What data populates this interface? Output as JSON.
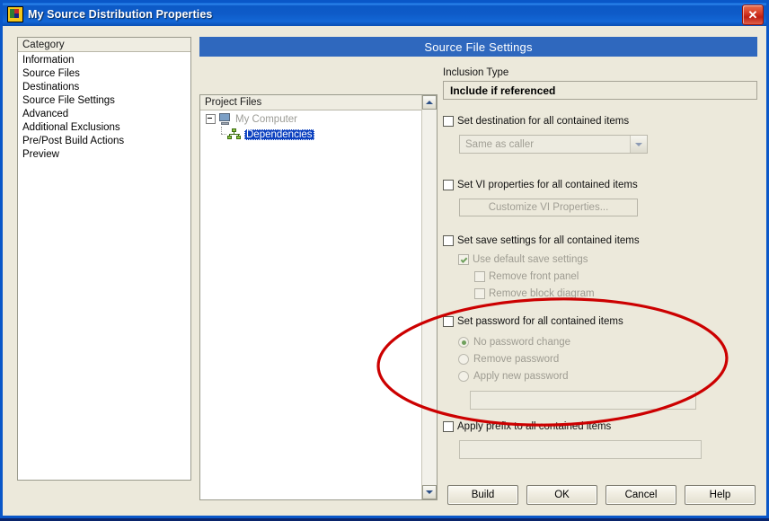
{
  "window": {
    "title": "My Source Distribution Properties",
    "app_icon": "labview-icon",
    "close_label": "✕",
    "titlebar_color": "#0C59C6",
    "background_color": "#ECE9DB"
  },
  "category": {
    "header": "Category",
    "items": [
      {
        "label": "Information",
        "selected": false
      },
      {
        "label": "Source Files",
        "selected": false
      },
      {
        "label": "Destinations",
        "selected": false
      },
      {
        "label": "Source File Settings",
        "selected": true
      },
      {
        "label": "Advanced",
        "selected": false
      },
      {
        "label": "Additional Exclusions",
        "selected": false
      },
      {
        "label": "Pre/Post Build Actions",
        "selected": false
      },
      {
        "label": "Preview",
        "selected": false
      }
    ],
    "selection_color": "#0A3FBF"
  },
  "tree": {
    "header": "Project Files",
    "nodes": [
      {
        "label": "My Computer",
        "icon": "computer-icon",
        "state": "dimmed",
        "expander": "minus"
      },
      {
        "label": "Dependencies",
        "icon": "dependencies-icon",
        "state": "selected"
      }
    ],
    "scrollbar": {
      "up": "▲",
      "down": "▼"
    }
  },
  "panel": {
    "header": "Source File Settings",
    "header_color": "#2F68BE",
    "inclusion": {
      "label": "Inclusion Type",
      "value": "Include if referenced"
    },
    "destination": {
      "checkbox_label": "Set destination for all contained items",
      "checked": false,
      "combo_value": "Same as caller",
      "combo_disabled": true
    },
    "vi_properties": {
      "checkbox_label": "Set VI properties for all contained items",
      "checked": false,
      "button_label": "Customize VI Properties...",
      "button_disabled": true
    },
    "save_settings": {
      "checkbox_label": "Set save settings for all contained items",
      "checked": false,
      "use_default": {
        "label": "Use default save settings",
        "checked": true,
        "disabled": true
      },
      "remove_front_panel": {
        "label": "Remove front panel",
        "checked": false,
        "disabled": true
      },
      "remove_block_diagram": {
        "label": "Remove block diagram",
        "checked": false,
        "disabled": true
      }
    },
    "password": {
      "checkbox_label": "Set password for all contained items",
      "checked": false,
      "options": [
        {
          "label": "No password change",
          "selected": true
        },
        {
          "label": "Remove password",
          "selected": false
        },
        {
          "label": "Apply new password",
          "selected": false
        }
      ],
      "field_value": "",
      "field_disabled": true
    },
    "prefix": {
      "checkbox_label": "Apply prefix to all contained items",
      "checked": false,
      "field_value": "",
      "field_disabled": true
    }
  },
  "buttons": [
    {
      "label": "Build"
    },
    {
      "label": "OK"
    },
    {
      "label": "Cancel"
    },
    {
      "label": "Help"
    }
  ],
  "annotation": {
    "shape": "ellipse",
    "color": "#CC0000",
    "stroke_width": 3
  }
}
